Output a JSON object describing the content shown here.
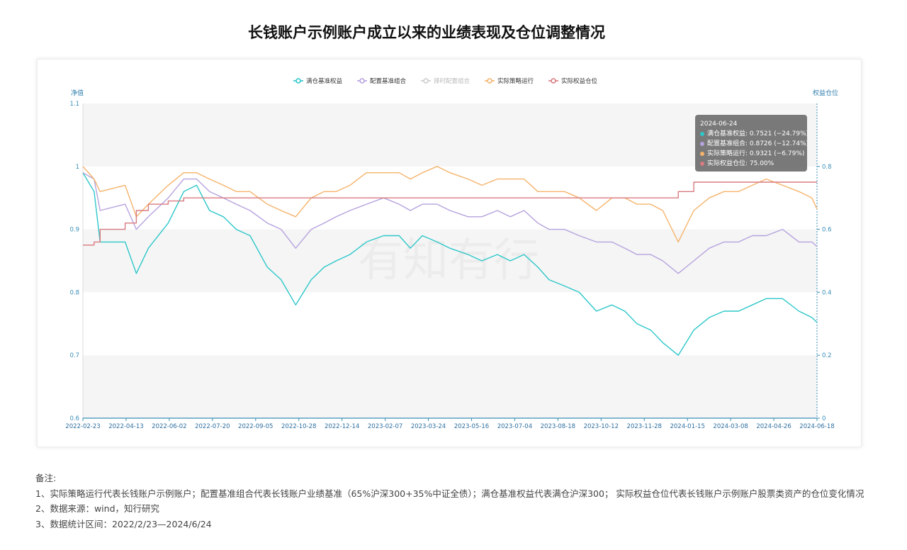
{
  "page": {
    "title": "长钱账户示例账户成立以来的业绩表现及仓位调整情况"
  },
  "chart_data": {
    "type": "line",
    "title": "",
    "y_left_label": "净值",
    "y_right_label": "权益仓位",
    "ylim_left": [
      0.6,
      1.1
    ],
    "ylim_right": [
      0,
      1.0
    ],
    "y_left_ticks": [
      "0.6",
      "0.7",
      "0.8",
      "0.9",
      "1",
      "1.1"
    ],
    "y_right_ticks": [
      "0",
      "0.2",
      "0.4",
      "0.6",
      "0.8"
    ],
    "x_tick_labels": [
      "2022-02-23",
      "2022-04-13",
      "2022-06-02",
      "2022-07-20",
      "2022-09-05",
      "2022-10-28",
      "2022-12-14",
      "2023-02-07",
      "2023-03-24",
      "2023-05-16",
      "2023-07-04",
      "2023-08-18",
      "2023-10-12",
      "2023-11-28",
      "2024-01-15",
      "2024-03-08",
      "2024-04-26",
      "2024-06-18"
    ],
    "legend_position": "top-center",
    "grid": "alternating-bands",
    "watermark": "有知有行",
    "x": [
      "2022-02-23",
      "2022-03-08",
      "2022-03-15",
      "2022-04-13",
      "2022-04-26",
      "2022-05-10",
      "2022-06-02",
      "2022-06-20",
      "2022-07-05",
      "2022-07-20",
      "2022-08-05",
      "2022-08-20",
      "2022-09-05",
      "2022-09-25",
      "2022-10-11",
      "2022-10-28",
      "2022-11-15",
      "2022-11-30",
      "2022-12-14",
      "2022-12-30",
      "2023-01-18",
      "2023-02-07",
      "2023-02-25",
      "2023-03-10",
      "2023-03-24",
      "2023-04-10",
      "2023-04-25",
      "2023-05-16",
      "2023-06-01",
      "2023-06-19",
      "2023-07-04",
      "2023-07-20",
      "2023-08-05",
      "2023-08-18",
      "2023-09-05",
      "2023-09-22",
      "2023-10-12",
      "2023-10-30",
      "2023-11-14",
      "2023-11-28",
      "2023-12-14",
      "2023-12-28",
      "2024-01-15",
      "2024-02-02",
      "2024-02-20",
      "2024-03-08",
      "2024-03-25",
      "2024-04-10",
      "2024-04-26",
      "2024-05-15",
      "2024-06-03",
      "2024-06-18",
      "2024-06-24"
    ],
    "series": [
      {
        "name": "满仓基准权益",
        "color": "#2ec7c9",
        "values": [
          0.99,
          0.96,
          0.88,
          0.88,
          0.83,
          0.87,
          0.91,
          0.96,
          0.97,
          0.93,
          0.92,
          0.9,
          0.89,
          0.84,
          0.82,
          0.78,
          0.82,
          0.84,
          0.85,
          0.86,
          0.88,
          0.89,
          0.89,
          0.87,
          0.89,
          0.88,
          0.87,
          0.86,
          0.85,
          0.86,
          0.85,
          0.86,
          0.84,
          0.82,
          0.81,
          0.8,
          0.77,
          0.78,
          0.77,
          0.75,
          0.74,
          0.72,
          0.7,
          0.74,
          0.76,
          0.77,
          0.77,
          0.78,
          0.79,
          0.79,
          0.77,
          0.76,
          0.7521
        ]
      },
      {
        "name": "配置基准组合",
        "color": "#b6a2de",
        "values": [
          0.99,
          0.98,
          0.93,
          0.94,
          0.9,
          0.92,
          0.95,
          0.98,
          0.98,
          0.96,
          0.95,
          0.94,
          0.93,
          0.91,
          0.9,
          0.87,
          0.9,
          0.91,
          0.92,
          0.93,
          0.94,
          0.95,
          0.94,
          0.93,
          0.94,
          0.94,
          0.93,
          0.92,
          0.92,
          0.93,
          0.92,
          0.93,
          0.91,
          0.9,
          0.9,
          0.89,
          0.88,
          0.88,
          0.87,
          0.86,
          0.86,
          0.85,
          0.83,
          0.85,
          0.87,
          0.88,
          0.88,
          0.89,
          0.89,
          0.9,
          0.88,
          0.88,
          0.8726
        ]
      },
      {
        "name": "择时配置组合",
        "color": "#cccccc",
        "hidden": true,
        "values": []
      },
      {
        "name": "实际策略运行",
        "color": "#f5b36b",
        "values": [
          1.0,
          0.98,
          0.96,
          0.97,
          0.92,
          0.94,
          0.97,
          0.99,
          0.99,
          0.98,
          0.97,
          0.96,
          0.96,
          0.94,
          0.93,
          0.92,
          0.95,
          0.96,
          0.96,
          0.97,
          0.99,
          0.99,
          0.99,
          0.98,
          0.99,
          1.0,
          0.99,
          0.98,
          0.97,
          0.98,
          0.98,
          0.98,
          0.96,
          0.96,
          0.96,
          0.95,
          0.93,
          0.95,
          0.95,
          0.94,
          0.94,
          0.93,
          0.88,
          0.93,
          0.95,
          0.96,
          0.96,
          0.97,
          0.98,
          0.97,
          0.96,
          0.95,
          0.9321
        ]
      },
      {
        "name": "实际权益仓位",
        "color": "#d87a80",
        "axis": "right",
        "values": [
          0.55,
          0.56,
          0.6,
          0.62,
          0.66,
          0.68,
          0.69,
          0.7,
          0.7,
          0.7,
          0.7,
          0.7,
          0.7,
          0.7,
          0.7,
          0.7,
          0.7,
          0.7,
          0.7,
          0.7,
          0.7,
          0.7,
          0.7,
          0.7,
          0.7,
          0.7,
          0.7,
          0.7,
          0.7,
          0.7,
          0.7,
          0.7,
          0.7,
          0.7,
          0.7,
          0.7,
          0.7,
          0.7,
          0.7,
          0.7,
          0.7,
          0.7,
          0.72,
          0.75,
          0.75,
          0.75,
          0.75,
          0.75,
          0.75,
          0.75,
          0.75,
          0.75,
          0.75
        ]
      }
    ],
    "tooltip": {
      "date": "2024-06-24",
      "rows": [
        {
          "label": "满仓基准权益: 0.7521 (−24.79%)",
          "color": "#2ec7c9"
        },
        {
          "label": "配置基准组合: 0.8726 (−12.74%)",
          "color": "#b6a2de"
        },
        {
          "label": "实际策略运行: 0.9321 (−6.79%)",
          "color": "#f5b36b"
        },
        {
          "label": "实际权益仓位: 75.00%",
          "color": "#d87a80"
        }
      ]
    }
  },
  "notes": {
    "heading": "备注:",
    "lines": [
      "1、实际策略运行代表长钱账户示例账户；配置基准组合代表长钱账户业绩基准（65%沪深300+35%中证全债）；满仓基准权益代表满仓沪深300；  实际权益仓位代表长钱账户示例账户股票类资产的仓位变化情况",
      "2、数据来源：wind，知行研究",
      "3、数据统计区间：2022/2/23—2024/6/24"
    ]
  }
}
